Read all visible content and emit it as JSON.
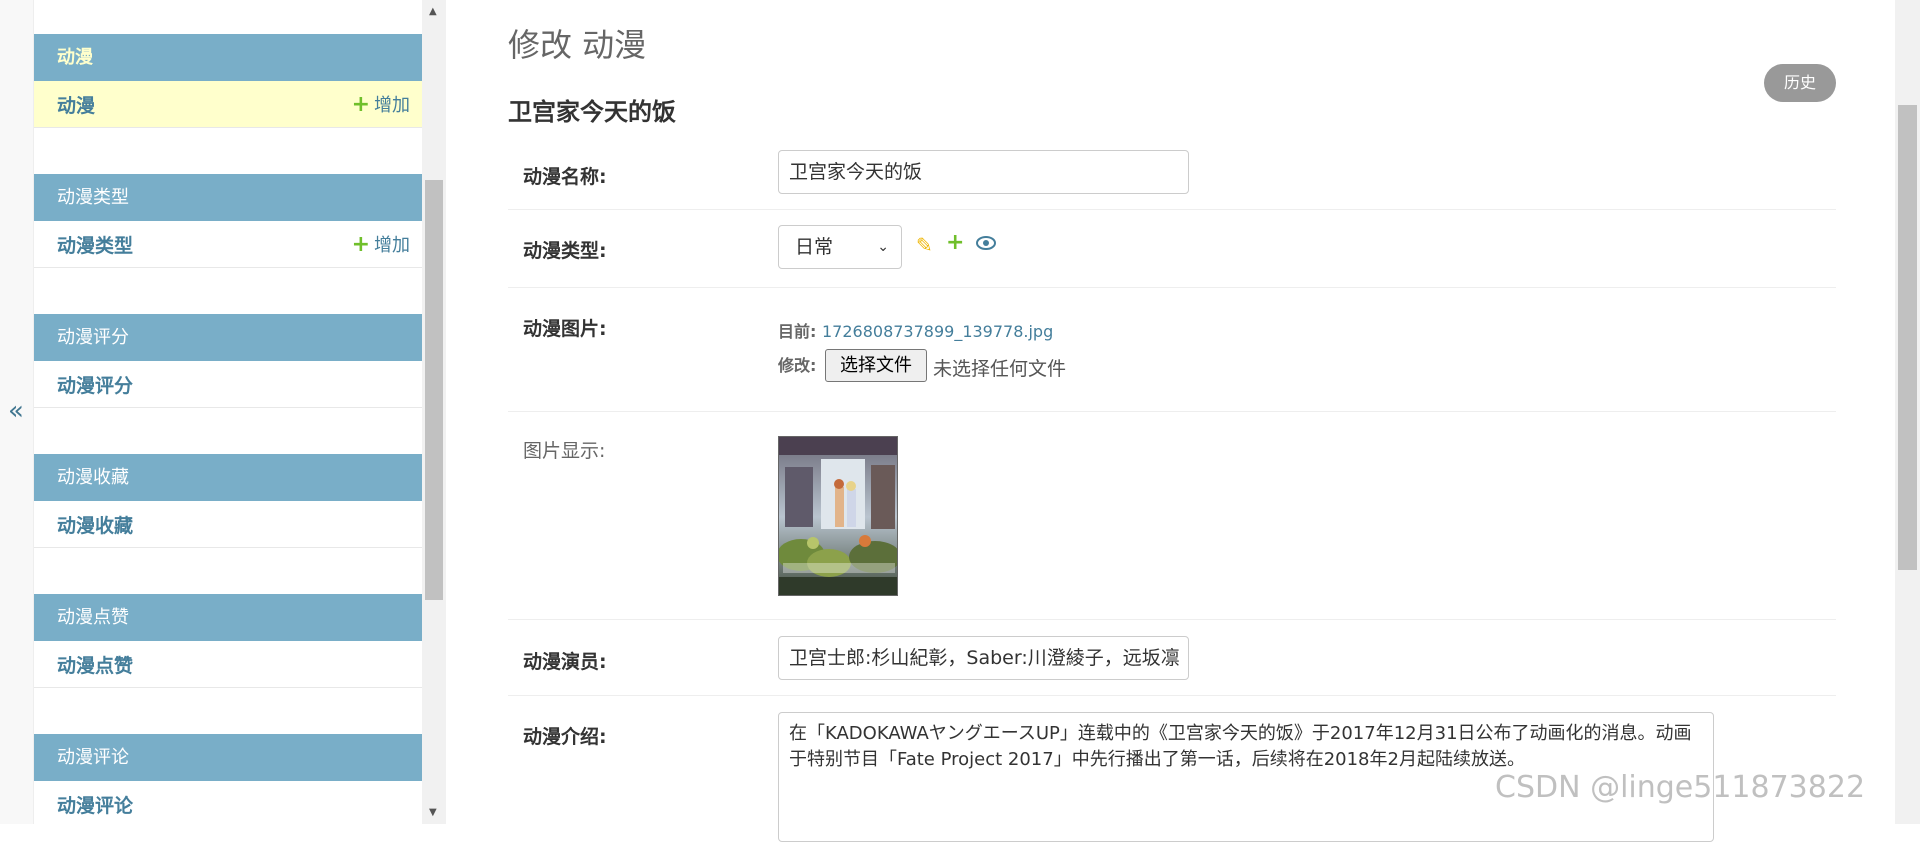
{
  "sidebar": {
    "modules": [
      {
        "header": "动漫",
        "item": "动漫",
        "add": "增加",
        "active": true
      },
      {
        "header": "动漫类型",
        "item": "动漫类型",
        "add": "增加"
      },
      {
        "header": "动漫评分",
        "item": "动漫评分"
      },
      {
        "header": "动漫收藏",
        "item": "动漫收藏"
      },
      {
        "header": "动漫点赞",
        "item": "动漫点赞"
      },
      {
        "header": "动漫评论",
        "item": "动漫评论"
      }
    ],
    "collapse_glyph": "«"
  },
  "page": {
    "title": "修改 动漫",
    "object_title": "卫宫家今天的饭",
    "history": "历史"
  },
  "form": {
    "name": {
      "label": "动漫名称:",
      "value": "卫宫家今天的饭"
    },
    "type": {
      "label": "动漫类型:",
      "value": "日常"
    },
    "image": {
      "label": "动漫图片:",
      "current_label": "目前:",
      "current_file": "1726808737899_139778.jpg",
      "change_label": "修改:",
      "choose_button": "选择文件",
      "no_file": "未选择任何文件"
    },
    "preview": {
      "label": "图片显示:"
    },
    "cast": {
      "label": "动漫演员:",
      "value": "卫宫士郎:杉山紀彰，Saber:川澄綾子，远坂凛"
    },
    "intro": {
      "label": "动漫介绍:",
      "value": "在「KADOKAWAヤングエースUP」连载中的《卫宫家今天的饭》于2017年12月31日公布了动画化的消息。动画于特别节目「Fate Project 2017」中先行播出了第一话，后续将在2018年2月起陆续放送。"
    }
  },
  "watermark": "CSDN @linge511873822",
  "icons": {
    "edit": "pencil-icon",
    "add": "plus-icon",
    "view": "eye-icon"
  },
  "colors": {
    "accent": "#79aec8",
    "link": "#447e9b",
    "add": "#70bf2b",
    "edit": "#efb80b",
    "current_row": "#ffffcc"
  }
}
